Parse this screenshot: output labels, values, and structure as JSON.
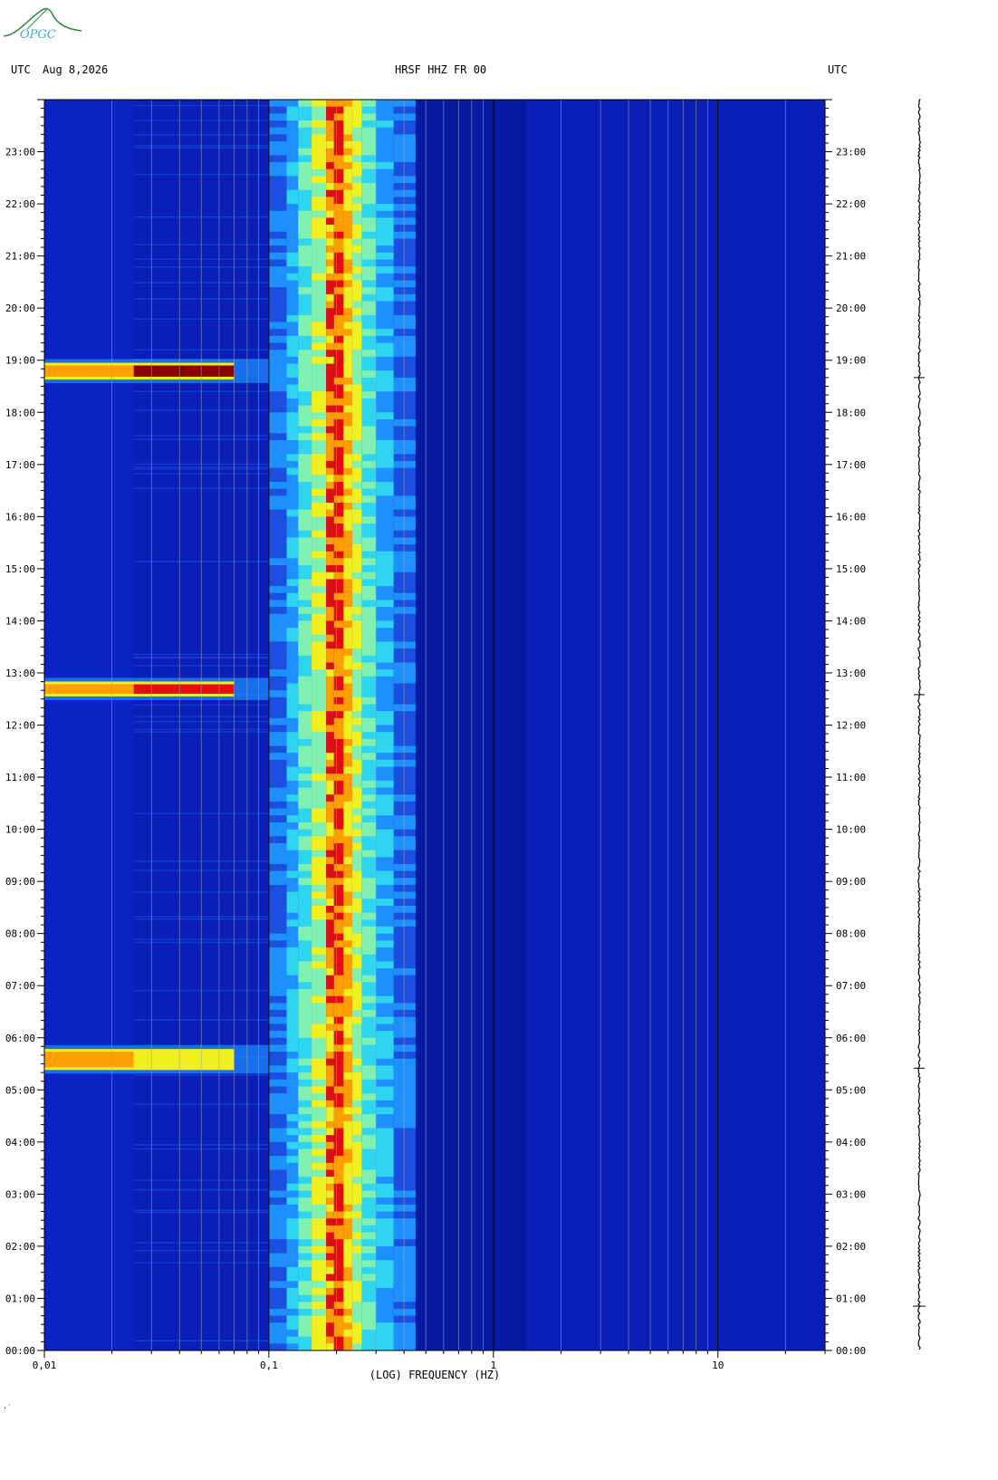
{
  "header": {
    "left_timezone": "UTC",
    "date": "Aug 8,2026",
    "station": "HRSF HHZ FR 00",
    "right_timezone": "UTC"
  },
  "logo": {
    "text": "OPGC",
    "color": "#2a8a3a",
    "accent": "#3aa7d6"
  },
  "chart_data": {
    "type": "heatmap",
    "title": "HRSF HHZ FR 00",
    "xlabel": "(LOG) FREQUENCY (HZ)",
    "ylabel": "",
    "x_scale": "log",
    "xlim": [
      0.01,
      30
    ],
    "ylim_hours": [
      0,
      24
    ],
    "x_ticks": [
      "0,01",
      "0,1",
      "1",
      "10"
    ],
    "y_ticks": [
      "00:00",
      "01:00",
      "02:00",
      "03:00",
      "04:00",
      "05:00",
      "06:00",
      "07:00",
      "08:00",
      "09:00",
      "10:00",
      "11:00",
      "12:00",
      "13:00",
      "14:00",
      "15:00",
      "16:00",
      "17:00",
      "18:00",
      "19:00",
      "20:00",
      "21:00",
      "22:00",
      "23:00"
    ],
    "background_color": "#0a1fb8",
    "colormap": [
      "#00008f",
      "#0a1fb8",
      "#1a4fe0",
      "#1e90ff",
      "#2fd4f0",
      "#7ff0b0",
      "#f0f020",
      "#ffa000",
      "#e01010",
      "#8b0000"
    ],
    "microseism_band_hz": [
      0.13,
      0.4
    ],
    "microseism_peak_hz": [
      0.18,
      0.26
    ],
    "events": [
      {
        "time_start": "18:40",
        "time_end": "18:55",
        "freq_max_hz": 0.1,
        "peak": "dark-red"
      },
      {
        "time_start": "12:35",
        "time_end": "12:48",
        "freq_max_hz": 0.1,
        "peak": "red"
      },
      {
        "time_start": "05:25",
        "time_end": "05:45",
        "freq_max_hz": 0.1,
        "peak": "yellow"
      }
    ],
    "grid": true
  },
  "footer": {
    "mark": "·˙"
  }
}
